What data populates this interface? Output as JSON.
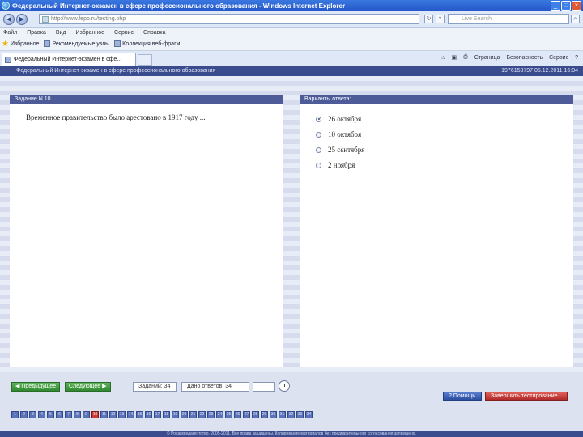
{
  "window": {
    "title": "Федеральный Интернет-экзамен в сфере профессионального образования - Windows Internet Explorer",
    "minimize": "_",
    "maximize": "□",
    "close": "×"
  },
  "addressbar": {
    "url": "http://www.fepo.ru/testing.php",
    "search_placeholder": "Live Search",
    "refresh": "↻",
    "stop": "×",
    "search_go": "⌕"
  },
  "menubar": {
    "items": [
      "Файл",
      "Правка",
      "Вид",
      "Избранное",
      "Сервис",
      "Справка"
    ]
  },
  "favbar": {
    "label": "Избранное",
    "items": [
      "Рекомендуемые узлы",
      "Коллекция веб-фрагм..."
    ]
  },
  "tab": {
    "label": "Федеральный Интернет-экзамен в сфе..."
  },
  "tools": {
    "items": [
      "Страница",
      "Безопасность",
      "Сервис"
    ]
  },
  "header": {
    "title": "Федеральный Интернет-экзамен в сфере профессионального образования",
    "session": "1976153797 05.12.2011 16:04"
  },
  "task": {
    "heading": "Задание N 10.",
    "question": "Временное правительство было арестовано в 1917 году ..."
  },
  "answers": {
    "heading": "Варианты ответа:",
    "options": [
      "26 октября",
      "10 октября",
      "25 сентября",
      "2 ноября"
    ],
    "selected_index": 0
  },
  "controls": {
    "prev": "Предыдущее",
    "next": "Следующее",
    "tasks_label": "Заданий: 34",
    "answered_label": "Дано ответов: 34",
    "timer": "",
    "help": "Помощь",
    "finish": "Завершить тестирование"
  },
  "question_nav": {
    "numbers": [
      "1",
      "2",
      "3",
      "4",
      "5",
      "6",
      "7",
      "8",
      "9",
      "10",
      "11",
      "12",
      "13",
      "14",
      "15",
      "16",
      "17",
      "18",
      "19",
      "20",
      "21",
      "22",
      "23",
      "24",
      "25",
      "26",
      "27",
      "28",
      "29",
      "30",
      "31",
      "32",
      "33",
      "34"
    ],
    "current": "10"
  },
  "footer": {
    "text": "© Росаккредагентство, 2005-2011. Все права защищены. Копирование материалов без предварительного согласования запрещено."
  }
}
